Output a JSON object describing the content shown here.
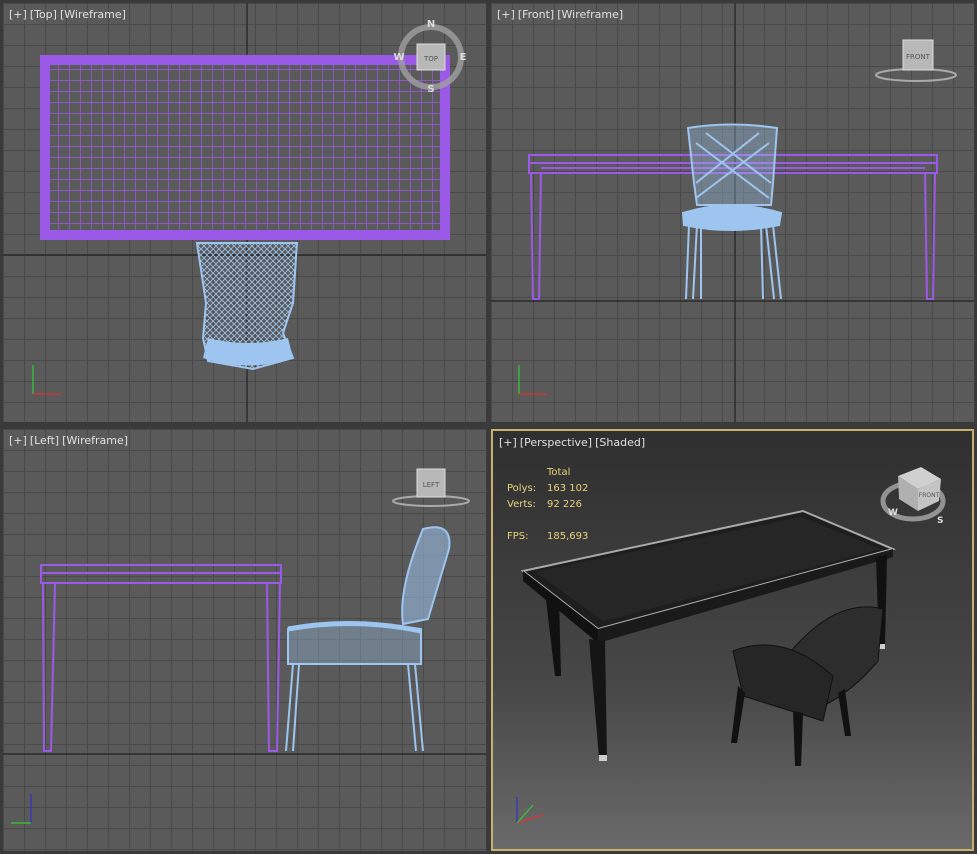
{
  "viewports": [
    {
      "id": "top",
      "label_plus": "[+]",
      "label_view": "[Top]",
      "label_mode": "[Wireframe]",
      "nav_text": "TOP",
      "compass": {
        "n": "N",
        "e": "E",
        "s": "S",
        "w": "W"
      }
    },
    {
      "id": "front",
      "label_plus": "[+]",
      "label_view": "[Front]",
      "label_mode": "[Wireframe]",
      "nav_text": "FRONT"
    },
    {
      "id": "left",
      "label_plus": "[+]",
      "label_view": "[Left]",
      "label_mode": "[Wireframe]",
      "nav_text": "LEFT"
    },
    {
      "id": "perspective",
      "label_plus": "[+]",
      "label_view": "[Perspective]",
      "label_mode": "[Shaded]",
      "nav_text": "FRONT",
      "compass": {
        "s": "S",
        "w": "W"
      }
    }
  ],
  "stats": {
    "header": "Total",
    "polys_label": "Polys:",
    "polys_value": "163 102",
    "verts_label": "Verts:",
    "verts_value": "92 226",
    "fps_label": "FPS:",
    "fps_value": "185,693"
  },
  "colors": {
    "table_wire": "#9b59e8",
    "chair_wire": "#9ec5ef",
    "active_border": "#c8b16d",
    "grid": "#4a4a4a",
    "bg": "#5a5a5a"
  }
}
